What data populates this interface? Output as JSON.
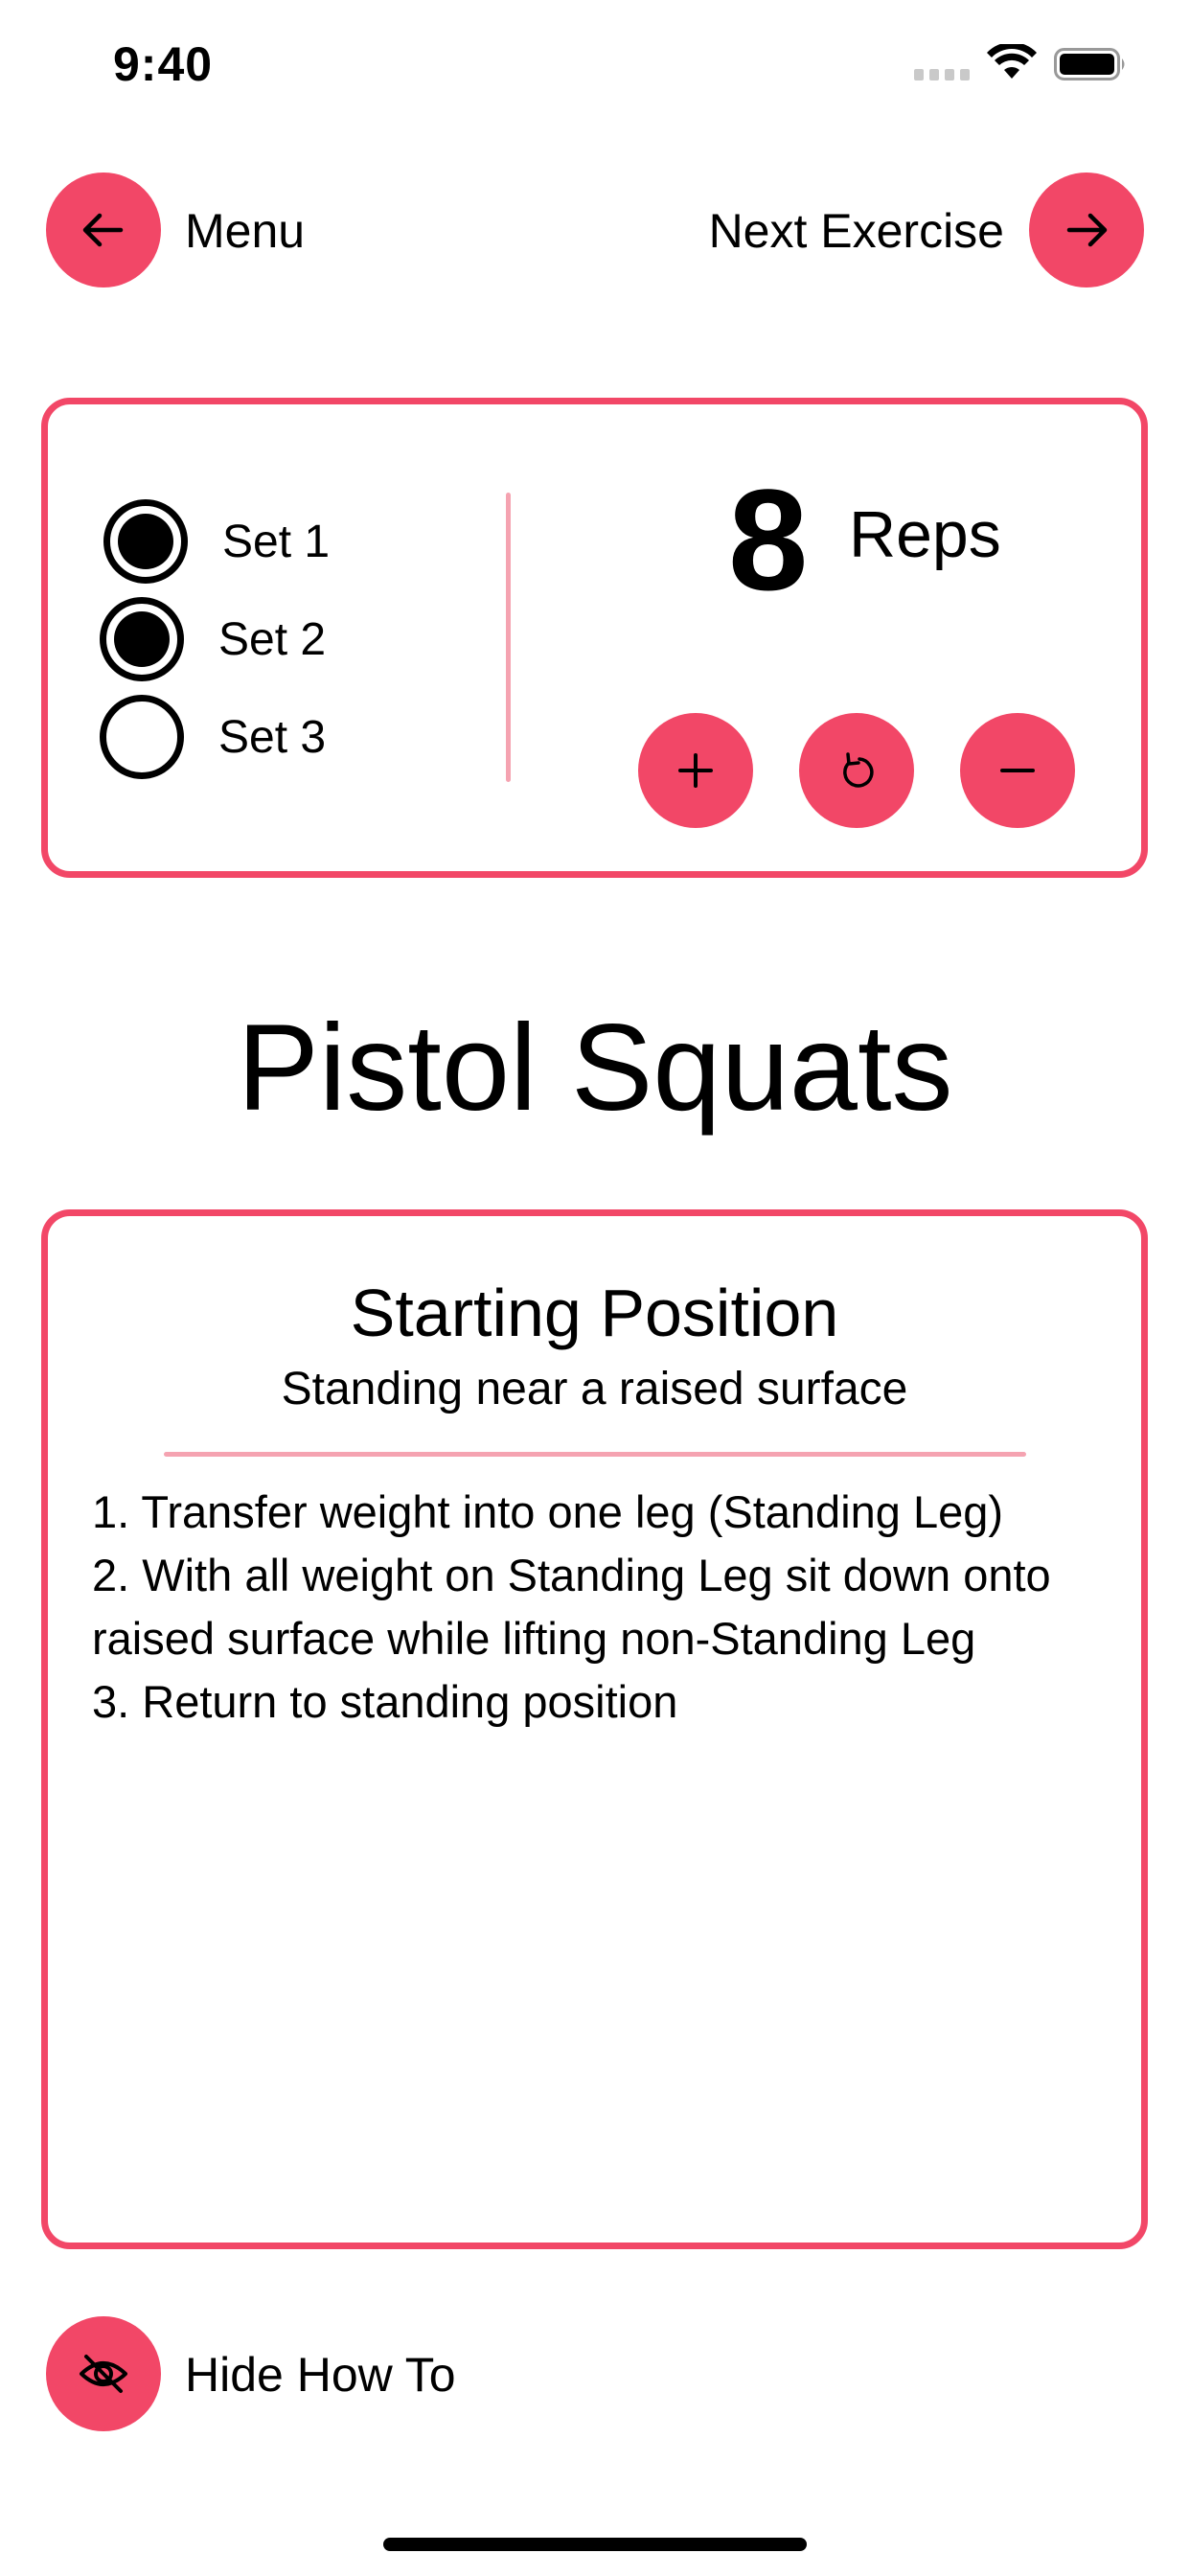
{
  "status_bar": {
    "time": "9:40"
  },
  "nav": {
    "menu_label": "Menu",
    "next_label": "Next Exercise"
  },
  "sets": [
    {
      "label": "Set 1",
      "checked": true
    },
    {
      "label": "Set 2",
      "checked": true
    },
    {
      "label": "Set 3",
      "checked": false
    }
  ],
  "reps": {
    "count": "8",
    "label": "Reps"
  },
  "exercise": {
    "name": "Pistol Squats"
  },
  "howto": {
    "title": "Starting Position",
    "subtitle": "Standing near a raised surface",
    "steps": [
      "1. Transfer weight into one leg (Standing Leg)",
      "2. With all weight on Standing Leg sit down onto raised surface while lifting non-Standing Leg",
      "3. Return to standing position"
    ]
  },
  "footer": {
    "hide_label": "Hide How To"
  },
  "colors": {
    "accent": "#f24767",
    "divider": "#f5a3b1"
  }
}
